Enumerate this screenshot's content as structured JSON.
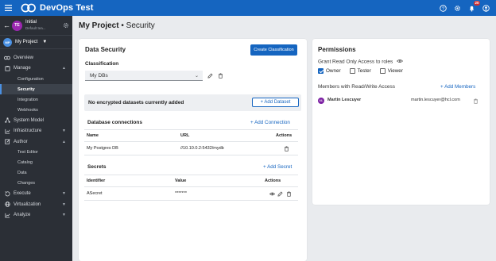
{
  "app": {
    "title": "DevOps Test",
    "notification_count": "20"
  },
  "sidebar": {
    "user": {
      "initials": "TE",
      "name": "Initial",
      "subtitle": "Default tea..."
    },
    "project": {
      "initials": "MP",
      "name": "My Project"
    },
    "items": [
      {
        "label": "Overview",
        "icon": "overview-icon"
      },
      {
        "label": "Manage",
        "icon": "manage-icon",
        "expanded": true
      },
      {
        "label": "Configuration"
      },
      {
        "label": "Security",
        "active": true
      },
      {
        "label": "Integration"
      },
      {
        "label": "Webhooks"
      },
      {
        "label": "System Model",
        "icon": "system-model-icon"
      },
      {
        "label": "Infrastructure",
        "icon": "infrastructure-icon"
      },
      {
        "label": "Author",
        "icon": "author-icon",
        "expanded": true
      },
      {
        "label": "Test Editor"
      },
      {
        "label": "Catalog"
      },
      {
        "label": "Data"
      },
      {
        "label": "Changes"
      },
      {
        "label": "Execute",
        "icon": "execute-icon"
      },
      {
        "label": "Virtualization",
        "icon": "virtualization-icon"
      },
      {
        "label": "Analyze",
        "icon": "analyze-icon"
      }
    ]
  },
  "page": {
    "title": "My Project",
    "separator": "•",
    "subtitle": "Security"
  },
  "data_security": {
    "heading": "Data Security",
    "create_button": "Create Classification",
    "classification_label": "Classification",
    "classification_value": "My DBs",
    "empty_banner": "No encrypted datasets currently added",
    "add_dataset": "+ Add Dataset",
    "db_connections": {
      "heading": "Database connections",
      "add_link": "+ Add Connection",
      "columns": [
        "Name",
        "URL",
        "Actions"
      ],
      "rows": [
        {
          "name": "My Postgres DB",
          "url": "//10.10.0.2:5432/mydb"
        }
      ]
    },
    "secrets": {
      "heading": "Secrets",
      "add_link": "+ Add Secret",
      "columns": [
        "Identifier",
        "Value",
        "Actions"
      ],
      "rows": [
        {
          "identifier": "ASecret",
          "value": "*******"
        }
      ]
    }
  },
  "permissions": {
    "heading": "Permissions",
    "grant_label": "Grant Read Only Access to roles",
    "roles": [
      {
        "label": "Owner",
        "checked": true
      },
      {
        "label": "Tester",
        "checked": false
      },
      {
        "label": "Viewer",
        "checked": false
      }
    ],
    "members_label": "Members with Read/Write Access",
    "add_members": "+ Add Members",
    "members": [
      {
        "initials": "ML",
        "name": "Martin Lescuyer",
        "email": "martin.lescuyer@hcl.com"
      }
    ]
  },
  "colors": {
    "topbar": "#1565c0",
    "sidebar": "#2b2f36",
    "accent": "#1565c0"
  }
}
